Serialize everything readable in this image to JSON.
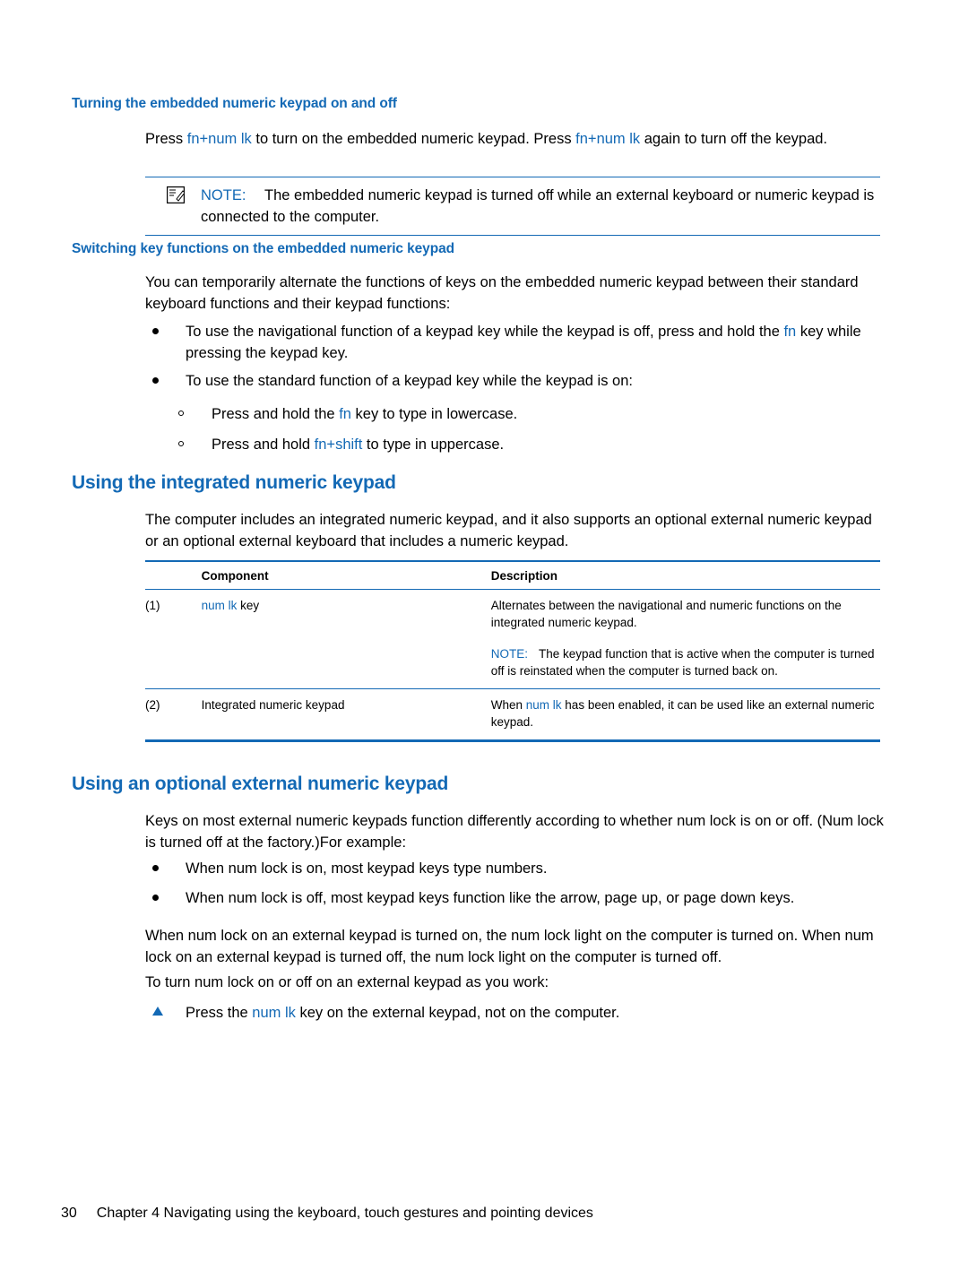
{
  "section1": {
    "heading": "Turning the embedded numeric keypad on and off",
    "para_pre": "Press ",
    "fn1": "fn",
    "plus1": "+",
    "numlk1": "num lk",
    "para_mid": " to turn on the embedded numeric keypad. Press ",
    "fn2": "fn",
    "plus2": "+",
    "numlk2": "num lk",
    "para_end": " again to turn off the keypad."
  },
  "note1": {
    "label": "NOTE:",
    "text": "The embedded numeric keypad is turned off while an external keyboard or numeric keypad is connected to the computer."
  },
  "section2": {
    "heading": "Switching key functions on the embedded numeric keypad",
    "para": "You can temporarily alternate the functions of keys on the embedded numeric keypad between their standard keyboard functions and their keypad functions:",
    "bullet1_a": "To use the navigational function of a keypad key while the keypad is off, press and hold the ",
    "bullet1_fn": "fn",
    "bullet1_b": " key while pressing the keypad key.",
    "bullet2": "To use the standard function of a keypad key while the keypad is on:",
    "sub1_a": "Press and hold the ",
    "sub1_fn": "fn",
    "sub1_b": " key to type in lowercase.",
    "sub2_a": "Press and hold ",
    "sub2_fn": "fn",
    "sub2_plus": "+",
    "sub2_shift": "shift",
    "sub2_b": " to type in uppercase."
  },
  "section3": {
    "heading": "Using the integrated numeric keypad",
    "para": "The computer includes an integrated numeric keypad, and it also supports an optional external numeric keypad or an optional external keyboard that includes a numeric keypad."
  },
  "table": {
    "headers": {
      "num": "",
      "component": "Component",
      "description": "Description"
    },
    "rows": [
      {
        "num": "(1)",
        "component_prefix": "num lk",
        "component_suffix": " key",
        "description": "Alternates between the navigational and numeric functions on the integrated numeric keypad.",
        "note_label": "NOTE:",
        "note_text": "The keypad function that is active when the computer is turned off is reinstated when the computer is turned back on."
      },
      {
        "num": "(2)",
        "component_prefix": "",
        "component_suffix": "Integrated numeric keypad",
        "description_pre": "When ",
        "description_link": "num lk",
        "description_post": " has been enabled, it can be used like an external numeric keypad."
      }
    ]
  },
  "section4": {
    "heading": "Using an optional external numeric keypad",
    "para": "Keys on most external numeric keypads function differently according to whether num lock is on or off. (Num lock is turned off at the factory.)For example:",
    "bullet1": "When num lock is on, most keypad keys type numbers.",
    "bullet2": "When num lock is off, most keypad keys function like the arrow, page up, or page down keys.",
    "para2": "When num lock on an external keypad is turned on, the num lock light on the computer is turned on. When num lock on an external keypad is turned off, the num lock light on the computer is turned off.",
    "para3": "To turn num lock on or off on an external keypad as you work:",
    "tri_a": "Press the ",
    "tri_link": "num lk",
    "tri_b": " key on the external keypad, not on the computer."
  },
  "footer": {
    "page": "30",
    "chapter": "Chapter 4   Navigating using the keyboard, touch gestures and pointing devices"
  },
  "colors": {
    "accent": "#1369b5",
    "text": "#000000"
  }
}
